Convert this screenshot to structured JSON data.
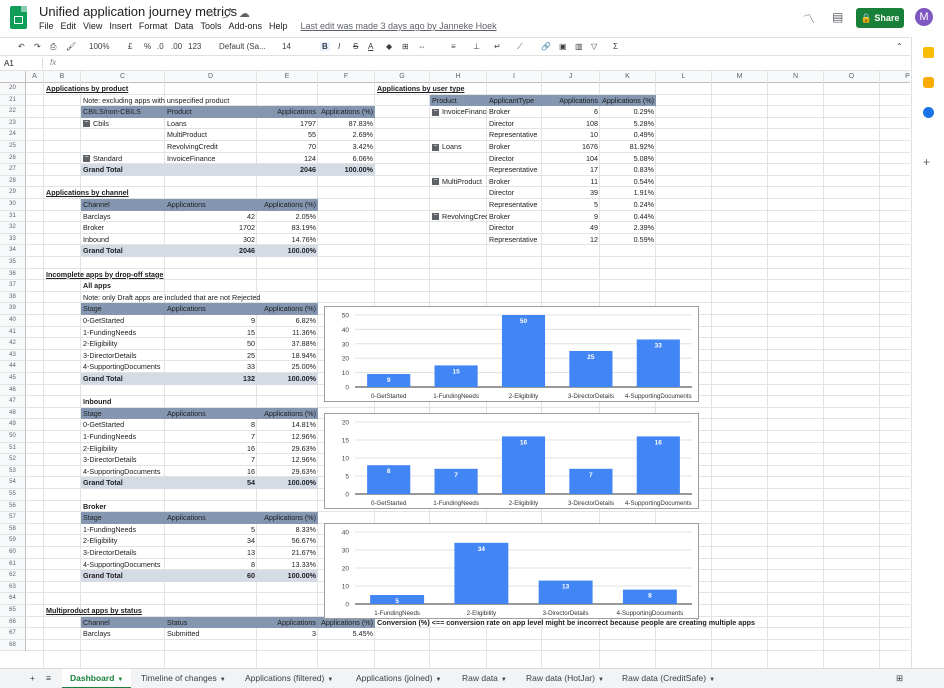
{
  "app": {
    "title": "Unified application journey metrics",
    "last_edit": "Last edit was made 3 days ago by Janneke Hoek",
    "share_label": "Share",
    "avatar_letter": "M",
    "logo_icon": "google-sheets-logo"
  },
  "menus": [
    "File",
    "Edit",
    "View",
    "Insert",
    "Format",
    "Data",
    "Tools",
    "Add-ons",
    "Help"
  ],
  "toolbar": {
    "zoom": "100%",
    "currency": "£",
    "percent": "%",
    "dec_less": ".0",
    "dec_more": ".00",
    "numfmt": "123",
    "font": "Default (Sa...",
    "size": "14",
    "bold": "B",
    "italic": "I",
    "strike": "S",
    "textcolor": "A"
  },
  "formula_bar": {
    "cell_ref": "A1",
    "fx": "fx"
  },
  "columns": [
    "A",
    "B",
    "C",
    "D",
    "E",
    "F",
    "G",
    "H",
    "I",
    "J",
    "K",
    "L",
    "M",
    "N",
    "O",
    "P"
  ],
  "rows": [
    "20",
    "21",
    "22",
    "23",
    "24",
    "25",
    "26",
    "27",
    "28",
    "29",
    "30",
    "31",
    "32",
    "33",
    "34",
    "35",
    "36",
    "37",
    "38",
    "39",
    "40",
    "41",
    "42",
    "43",
    "44",
    "45",
    "46",
    "47",
    "48",
    "49",
    "50",
    "51",
    "52",
    "53",
    "54",
    "55",
    "56",
    "57",
    "58",
    "59",
    "60",
    "61",
    "62",
    "63",
    "64",
    "65",
    "66",
    "67",
    "68"
  ],
  "product": {
    "title": "Applications by product",
    "note": "Note: excluding apps with unspecified product",
    "headers": [
      "CBILS/non-CBILS",
      "Product",
      "Applications",
      "Applications (%)"
    ],
    "rows": [
      [
        "Cbils",
        "Loans",
        "1797",
        "87.83%"
      ],
      [
        "",
        "MultiProduct",
        "55",
        "2.69%"
      ],
      [
        "",
        "RevolvingCredit",
        "70",
        "3.42%"
      ],
      [
        "Standard",
        "InvoiceFinance",
        "124",
        "6.06%"
      ]
    ],
    "total": [
      "Grand Total",
      "2046",
      "100.00%"
    ]
  },
  "usertype": {
    "title": "Applications by user type",
    "headers": [
      "Product",
      "ApplicantType",
      "Applications",
      "Applications (%)"
    ],
    "rows": [
      [
        "InvoiceFinance",
        "Broker",
        "6",
        "0.29%"
      ],
      [
        "",
        "Director",
        "108",
        "5.28%"
      ],
      [
        "",
        "Representative",
        "10",
        "0.49%"
      ],
      [
        "Loans",
        "Broker",
        "1676",
        "81.92%"
      ],
      [
        "",
        "Director",
        "104",
        "5.08%"
      ],
      [
        "",
        "Representative",
        "17",
        "0.83%"
      ],
      [
        "MultiProduct",
        "Broker",
        "11",
        "0.54%"
      ],
      [
        "",
        "Director",
        "39",
        "1.91%"
      ],
      [
        "",
        "Representative",
        "5",
        "0.24%"
      ],
      [
        "RevolvingCredit",
        "Broker",
        "9",
        "0.44%"
      ],
      [
        "",
        "Director",
        "49",
        "2.39%"
      ],
      [
        "",
        "Representative",
        "12",
        "0.59%"
      ]
    ]
  },
  "channel": {
    "title": "Applications by channel",
    "headers": [
      "Channel",
      "Applications",
      "Applications (%)"
    ],
    "rows": [
      [
        "Barclays",
        "42",
        "2.05%"
      ],
      [
        "Broker",
        "1702",
        "83.19%"
      ],
      [
        "Inbound",
        "302",
        "14.76%"
      ]
    ],
    "total": [
      "Grand Total",
      "2046",
      "100.00%"
    ]
  },
  "incomplete": {
    "title": "Incomplete apps by drop-off stage",
    "all": {
      "label": "All apps",
      "note": "Note: only Draft apps are included that are not Rejected",
      "headers": [
        "Stage",
        "Applications",
        "Applications (%)"
      ],
      "rows": [
        [
          "0-GetStarted",
          "9",
          "6.82%"
        ],
        [
          "1-FundingNeeds",
          "15",
          "11.36%"
        ],
        [
          "2-Eligibility",
          "50",
          "37.88%"
        ],
        [
          "3-DirectorDetails",
          "25",
          "18.94%"
        ],
        [
          "4-SupportingDocuments",
          "33",
          "25.00%"
        ]
      ],
      "total": [
        "Grand Total",
        "132",
        "100.00%"
      ]
    },
    "inbound": {
      "label": "Inbound",
      "headers": [
        "Stage",
        "Applications",
        "Applications (%)"
      ],
      "rows": [
        [
          "0-GetStarted",
          "8",
          "14.81%"
        ],
        [
          "1-FundingNeeds",
          "7",
          "12.96%"
        ],
        [
          "2-Eligibility",
          "16",
          "29.63%"
        ],
        [
          "3-DirectorDetails",
          "7",
          "12.96%"
        ],
        [
          "4-SupportingDocuments",
          "16",
          "29.63%"
        ]
      ],
      "total": [
        "Grand Total",
        "54",
        "100.00%"
      ]
    },
    "broker": {
      "label": "Broker",
      "headers": [
        "Stage",
        "Applications",
        "Applications (%)"
      ],
      "rows": [
        [
          "1-FundingNeeds",
          "5",
          "8.33%"
        ],
        [
          "2-Eligibility",
          "34",
          "56.67%"
        ],
        [
          "3-DirectorDetails",
          "13",
          "21.67%"
        ],
        [
          "4-SupportingDocuments",
          "8",
          "13.33%"
        ]
      ],
      "total": [
        "Grand Total",
        "60",
        "100.00%"
      ]
    }
  },
  "multiproduct": {
    "title": "Multiproduct apps by status",
    "headers": [
      "Channel",
      "Status",
      "Applications",
      "Applications (%)"
    ],
    "first_row": [
      "Barclays",
      "Submitted",
      "3",
      "5.45%"
    ],
    "conversion_note": "Conversion (%) <== conversion rate on app level might be incorrect because people are creating multiple apps"
  },
  "chart_data": [
    {
      "type": "bar",
      "categories": [
        "0-GetStarted",
        "1-FundingNeeds",
        "2-Eligibility",
        "3-DirectorDetails",
        "4-SupportingDocuments"
      ],
      "values": [
        9,
        15,
        50,
        25,
        33
      ],
      "ylim": [
        0,
        50
      ],
      "yticks": [
        0,
        10,
        20,
        30,
        40,
        50
      ],
      "color": "#4285f4"
    },
    {
      "type": "bar",
      "categories": [
        "0-GetStarted",
        "1-FundingNeeds",
        "2-Eligibility",
        "3-DirectorDetails",
        "4-SupportingDocuments"
      ],
      "values": [
        8,
        7,
        16,
        7,
        16
      ],
      "ylim": [
        0,
        20
      ],
      "yticks": [
        0,
        5,
        10,
        15,
        20
      ],
      "color": "#4285f4"
    },
    {
      "type": "bar",
      "categories": [
        "1-FundingNeeds",
        "2-Eligibility",
        "3-DirectorDetails",
        "4-SupportingDocuments"
      ],
      "values": [
        5,
        34,
        13,
        8
      ],
      "ylim": [
        0,
        40
      ],
      "yticks": [
        0,
        10,
        20,
        30,
        40
      ],
      "color": "#4285f4"
    }
  ],
  "tabs": [
    "Dashboard",
    "Timeline of changes",
    "Applications (filtered)",
    "Applications (joined)",
    "Raw data",
    "Raw data (HotJar)",
    "Raw data (CreditSafe)"
  ],
  "colors": {
    "header": "#8496b0",
    "total": "#d5dbe5",
    "accent": "#188038",
    "bar": "#4285f4"
  }
}
